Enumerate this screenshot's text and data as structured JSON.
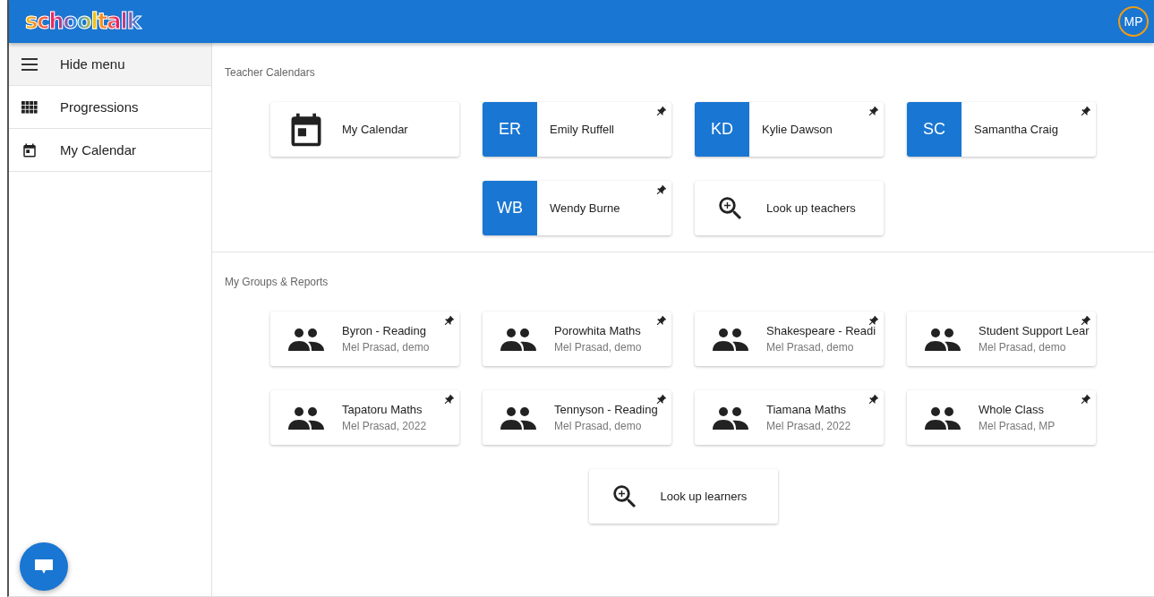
{
  "app_bar": {
    "logo": "schooltalk",
    "avatar": "MP"
  },
  "sidebar": {
    "items": [
      {
        "kind": "toggle",
        "label": "Hide menu",
        "selected": true
      },
      {
        "kind": "grid",
        "label": "Progressions",
        "selected": false
      },
      {
        "kind": "calendar",
        "label": "My Calendar",
        "selected": false
      }
    ]
  },
  "teacher_calendars": {
    "title": "Teacher Calendars",
    "cards": [
      {
        "kind": "calendar",
        "title": "My Calendar",
        "pinned": false
      },
      {
        "kind": "teacher",
        "initials": "ER",
        "title": "Emily Ruffell",
        "pinned": true
      },
      {
        "kind": "teacher",
        "initials": "KD",
        "title": "Kylie Dawson",
        "pinned": true
      },
      {
        "kind": "teacher",
        "initials": "SC",
        "title": "Samantha Craig",
        "pinned": true
      },
      {
        "kind": "teacher",
        "initials": "WB",
        "title": "Wendy Burne",
        "pinned": true
      },
      {
        "kind": "search",
        "title": "Look up teachers",
        "pinned": false
      }
    ]
  },
  "groups": {
    "title": "My Groups & Reports",
    "cards": [
      {
        "kind": "group",
        "title": "Byron - Reading",
        "subtitle": "Mel Prasad, demo",
        "pinned": true
      },
      {
        "kind": "group",
        "title": "Porowhita Maths",
        "subtitle": "Mel Prasad, demo",
        "pinned": true
      },
      {
        "kind": "group",
        "title": "Shakespeare - Readi",
        "subtitle": "Mel Prasad, demo",
        "pinned": true
      },
      {
        "kind": "group",
        "title": "Student Support Lear",
        "subtitle": "Mel Prasad, demo",
        "pinned": true
      },
      {
        "kind": "group",
        "title": "Tapatoru Maths",
        "subtitle": "Mel Prasad, 2022",
        "pinned": true
      },
      {
        "kind": "group",
        "title": "Tennyson - Reading",
        "subtitle": "Mel Prasad, demo",
        "pinned": true
      },
      {
        "kind": "group",
        "title": "Tiamana Maths",
        "subtitle": "Mel Prasad, 2022",
        "pinned": true
      },
      {
        "kind": "group",
        "title": "Whole Class",
        "subtitle": "Mel Prasad, MP",
        "pinned": true
      },
      {
        "kind": "search",
        "title": "Look up learners",
        "pinned": false
      }
    ]
  }
}
